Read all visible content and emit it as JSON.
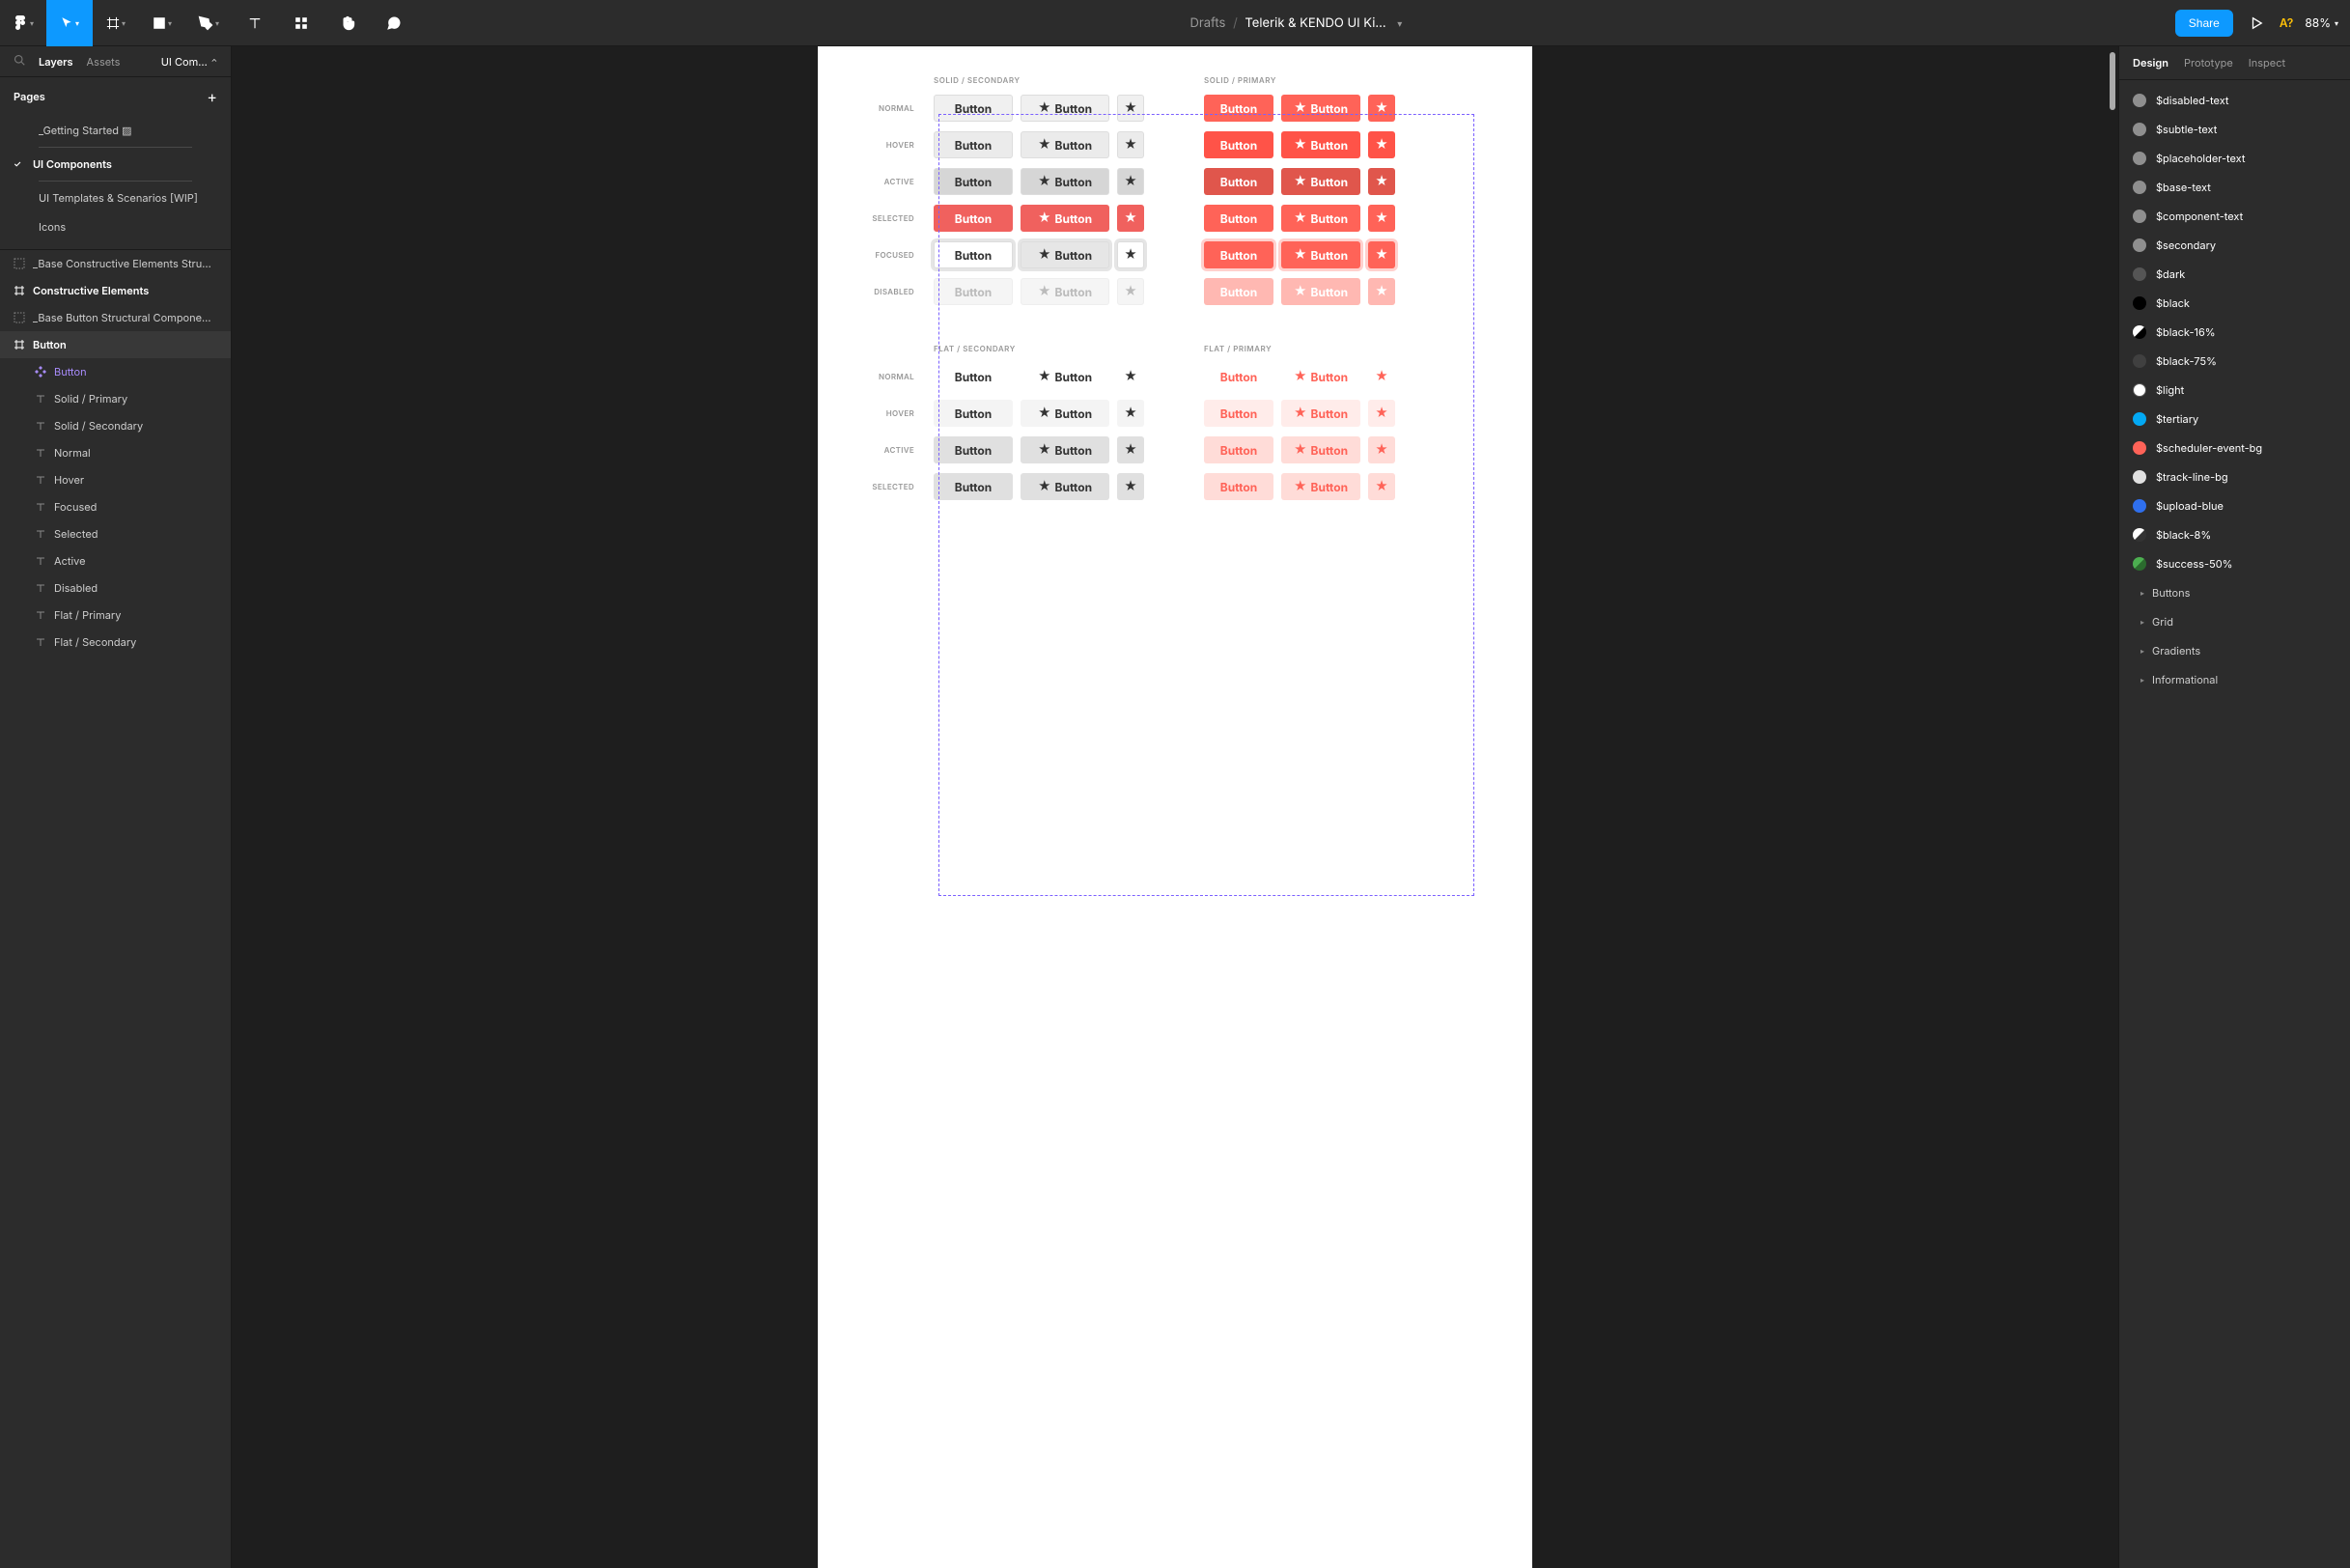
{
  "toolbar": {
    "breadcrumb_location": "Drafts",
    "breadcrumb_file": "Telerik & KENDO UI Ki…",
    "share_label": "Share",
    "user_badge": "A?",
    "zoom_level": "88%"
  },
  "left_panel": {
    "tabs": {
      "layers": "Layers",
      "assets": "Assets"
    },
    "team_select": "UI Com…",
    "pages_title": "Pages",
    "pages": {
      "getting_started": "_Getting Started ▨",
      "ui_components": "UI Components",
      "ui_templates": "UI Templates & Scenarios [WIP]",
      "icons": "Icons"
    },
    "layers": {
      "base_constructive": "_Base Constructive Elements Stru…",
      "constructive_elements": "Constructive Elements",
      "base_button": "_Base Button Structural Compone…",
      "button": "Button",
      "button_comp": "Button",
      "solid_primary": "Solid / Primary",
      "solid_secondary": "Solid / Secondary",
      "normal": "Normal",
      "hover": "Hover",
      "focused": "Focused",
      "selected": "Selected",
      "active": "Active",
      "disabled": "Disabled",
      "flat_primary": "Flat / Primary",
      "flat_secondary": "Flat / Secondary"
    }
  },
  "canvas": {
    "sections": {
      "solid_secondary": "SOLID / SECONDARY",
      "solid_primary": "SOLID / PRIMARY",
      "flat_secondary": "FLAT / SECONDARY",
      "flat_primary": "FLAT / PRIMARY"
    },
    "states": {
      "normal": "NORMAL",
      "hover": "HOVER",
      "active": "ACTIVE",
      "selected": "SELECTED",
      "focused": "FOCUSED",
      "disabled": "DISABLED"
    },
    "button_label": "Button"
  },
  "right_panel": {
    "tabs": {
      "design": "Design",
      "prototype": "Prototype",
      "inspect": "Inspect"
    },
    "styles": [
      {
        "name": "$disabled-text",
        "color": "#8f8f8f"
      },
      {
        "name": "$subtle-text",
        "color": "#8f8f8f"
      },
      {
        "name": "$placeholder-text",
        "color": "#8f8f8f"
      },
      {
        "name": "$base-text",
        "color": "#8f8f8f"
      },
      {
        "name": "$component-text",
        "color": "#8f8f8f"
      },
      {
        "name": "$secondary",
        "color": "#8f8f8f"
      },
      {
        "name": "$dark",
        "color": "#555555"
      },
      {
        "name": "$black",
        "color": "#000000"
      },
      {
        "name": "$black-16%",
        "color": "linear-gradient(135deg,#fff 50%,#000 50%)"
      },
      {
        "name": "$black-75%",
        "color": "#404040"
      },
      {
        "name": "$light",
        "color": "#ffffff"
      },
      {
        "name": "$tertiary",
        "color": "#03a9f4"
      },
      {
        "name": "$scheduler-event-bg",
        "color": "#ff6358"
      },
      {
        "name": "$track-line-bg",
        "color": "#e0e0e0"
      },
      {
        "name": "$upload-blue",
        "color": "#2f6fed"
      },
      {
        "name": "$black-8%",
        "color": "linear-gradient(135deg,#fff 50%,#333 50%)"
      },
      {
        "name": "$success-50%",
        "color": "linear-gradient(135deg,#4caf50 50%,#2b6b2e 50%)"
      }
    ],
    "folders": [
      "Buttons",
      "Grid",
      "Gradients",
      "Informational"
    ]
  }
}
